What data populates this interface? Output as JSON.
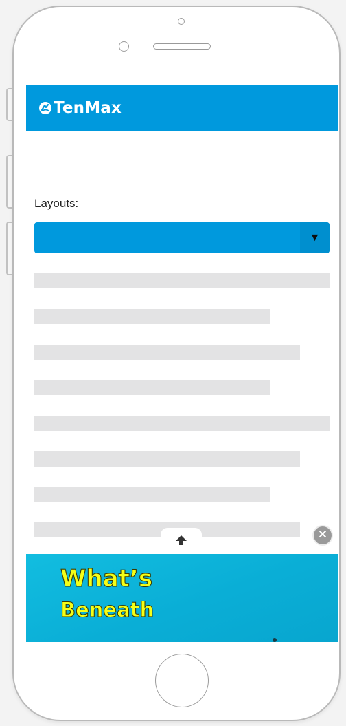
{
  "app": {
    "brand": "TenMax"
  },
  "form": {
    "layouts_label": "Layouts:",
    "layout_select_value": ""
  },
  "icons": {
    "brand_logo": "tenmax-logo-icon",
    "select_arrow": "caret-down-icon",
    "scroll_top": "arrow-up-icon",
    "close": "close-icon"
  },
  "ad": {
    "line1": "What’s",
    "line2": "Beneath"
  },
  "colors": {
    "brand_blue": "#0099dd",
    "skeleton_gray": "#e3e3e4",
    "ad_yellow": "#f4ff18",
    "ad_cyan": "#12bde0"
  }
}
